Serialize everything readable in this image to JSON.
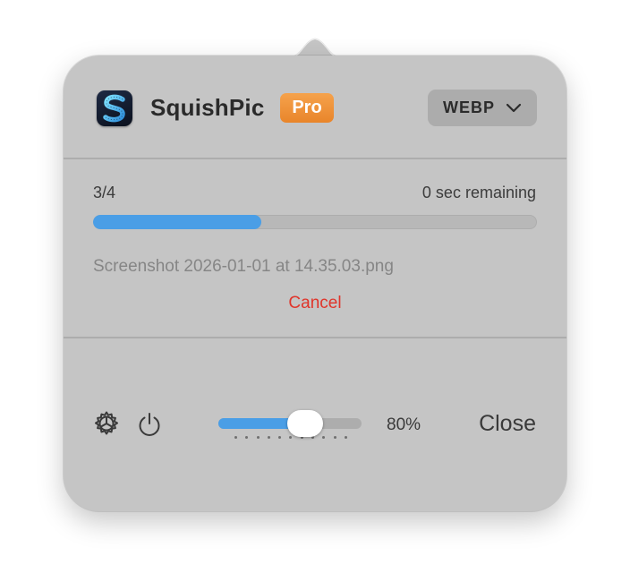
{
  "header": {
    "app_name": "SquishPic",
    "badge": "Pro",
    "app_icon": "squishpic-s-icon",
    "format_select": {
      "selected": "WEBP",
      "icon": "chevron-down-icon"
    }
  },
  "progress": {
    "count": "3/4",
    "remaining": "0 sec remaining",
    "fraction": 0.38,
    "current_file": "Screenshot 2026-01-01 at 14.35.03.png",
    "cancel_label": "Cancel"
  },
  "footer": {
    "settings_icon": "gear-icon",
    "power_icon": "power-icon",
    "quality": {
      "value": 0.8,
      "label": "80%",
      "tick_count": 11
    },
    "close_label": "Close"
  },
  "colors": {
    "panel": "#c5c5c5",
    "accent": "#4a9ee6",
    "badge": "#ee8b31",
    "cancel": "#e0352b"
  }
}
